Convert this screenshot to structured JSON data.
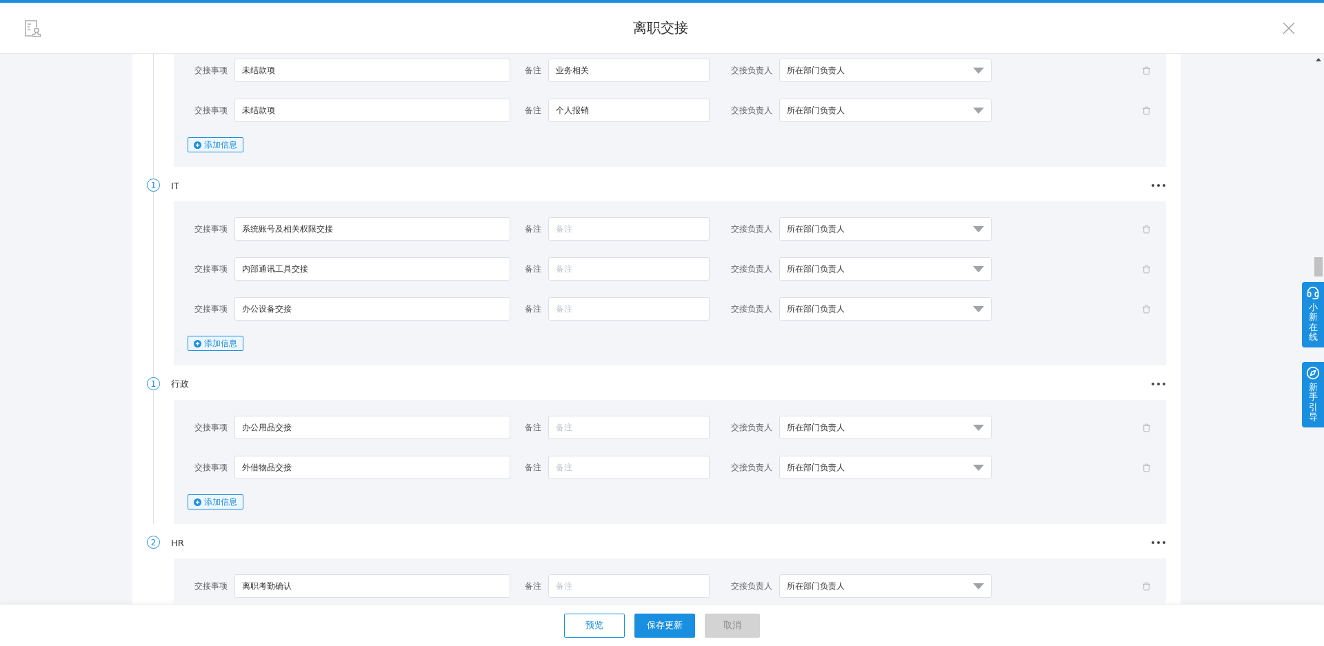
{
  "header": {
    "title": "离职交接"
  },
  "sections": [
    {
      "rows": [
        {
          "item_label": "交接事项",
          "item": "未结款项",
          "note_label": "备注",
          "note": "业务相关",
          "owner_label": "交接负责人",
          "owner": "所在部门负责人"
        },
        {
          "item_label": "交接事项",
          "item": "未结款项",
          "note_label": "备注",
          "note": "个人报销",
          "owner_label": "交接负责人",
          "owner": "所在部门负责人"
        }
      ],
      "add_button": "添加信息"
    },
    {
      "number": "1",
      "title": "IT",
      "rows": [
        {
          "item_label": "交接事项",
          "item": "系统账号及相关权限交接",
          "note_label": "备注",
          "note_placeholder": "备注",
          "owner_label": "交接负责人",
          "owner": "所在部门负责人"
        },
        {
          "item_label": "交接事项",
          "item": "内部通讯工具交接",
          "note_label": "备注",
          "note_placeholder": "备注",
          "owner_label": "交接负责人",
          "owner": "所在部门负责人"
        },
        {
          "item_label": "交接事项",
          "item": "办公设备交接",
          "note_label": "备注",
          "note_placeholder": "备注",
          "owner_label": "交接负责人",
          "owner": "所在部门负责人"
        }
      ],
      "add_button": "添加信息"
    },
    {
      "number": "1",
      "title": "行政",
      "rows": [
        {
          "item_label": "交接事项",
          "item": "办公用品交接",
          "note_label": "备注",
          "note_placeholder": "备注",
          "owner_label": "交接负责人",
          "owner": "所在部门负责人"
        },
        {
          "item_label": "交接事项",
          "item": "外借物品交接",
          "note_label": "备注",
          "note_placeholder": "备注",
          "owner_label": "交接负责人",
          "owner": "所在部门负责人"
        }
      ],
      "add_button": "添加信息"
    },
    {
      "number": "2",
      "title": "HR",
      "rows": [
        {
          "item_label": "交接事项",
          "item": "离职考勤确认",
          "note_label": "备注",
          "note_placeholder": "备注",
          "owner_label": "交接负责人",
          "owner": "所在部门负责人"
        }
      ]
    }
  ],
  "footer": {
    "buttons": [
      {
        "label": "预览",
        "kind": "outline"
      },
      {
        "label": "保存更新",
        "kind": "primary"
      },
      {
        "label": "取消",
        "kind": "disabled"
      }
    ]
  },
  "side_tabs": [
    {
      "label": "小新在线",
      "kind": "support"
    },
    {
      "label": "新手引导",
      "kind": "guide"
    }
  ]
}
